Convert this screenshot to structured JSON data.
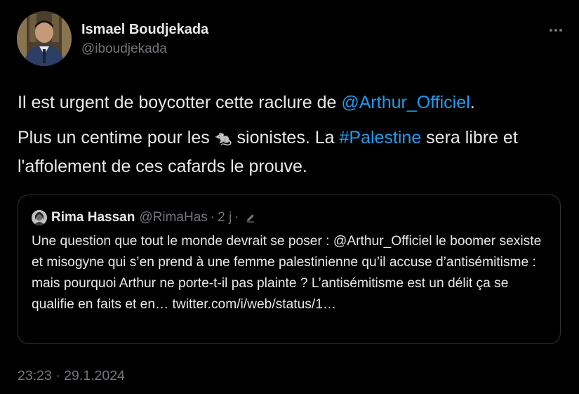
{
  "author": {
    "name": "Ismael Boudjekada",
    "handle": "@iboudjekada"
  },
  "more_icon": "more-horizontal-icon",
  "tweet": {
    "p1_text": "Il est urgent de boycotter cette raclure de ",
    "p1_mention": "@Arthur_Officiel",
    "p1_end": ".",
    "p2_text_a": "Plus un centime pour les ",
    "p2_emoji": "🐀",
    "p2_text_b": " sionistes. La ",
    "p2_hashtag": "#Palestine",
    "p2_text_c": " sera libre et l'affolement de ces cafards le prouve."
  },
  "quote": {
    "name": "Rima Hassan",
    "handle": "@RimaHas",
    "separator": "·",
    "time": "2 j",
    "edit_icon": "pencil-edit-icon",
    "text": "Une question que tout le monde devrait se poser : @Arthur_Officiel le boomer sexiste et misogyne qui s’en prend à une femme palestinienne qu’il accuse d’antisémitisme : mais pourquoi Arthur ne porte-t-il pas plainte ? L’antisémitisme est un délit ça se qualifie en faits et en… twitter.com/i/web/status/1…"
  },
  "timestamp": {
    "time": "23:23",
    "separator": "·",
    "date": "29.1.2024"
  },
  "colors": {
    "background": "#000000",
    "text": "#e7e9ea",
    "secondary": "#71767b",
    "link": "#1d9bf0",
    "border": "#2f3336"
  }
}
